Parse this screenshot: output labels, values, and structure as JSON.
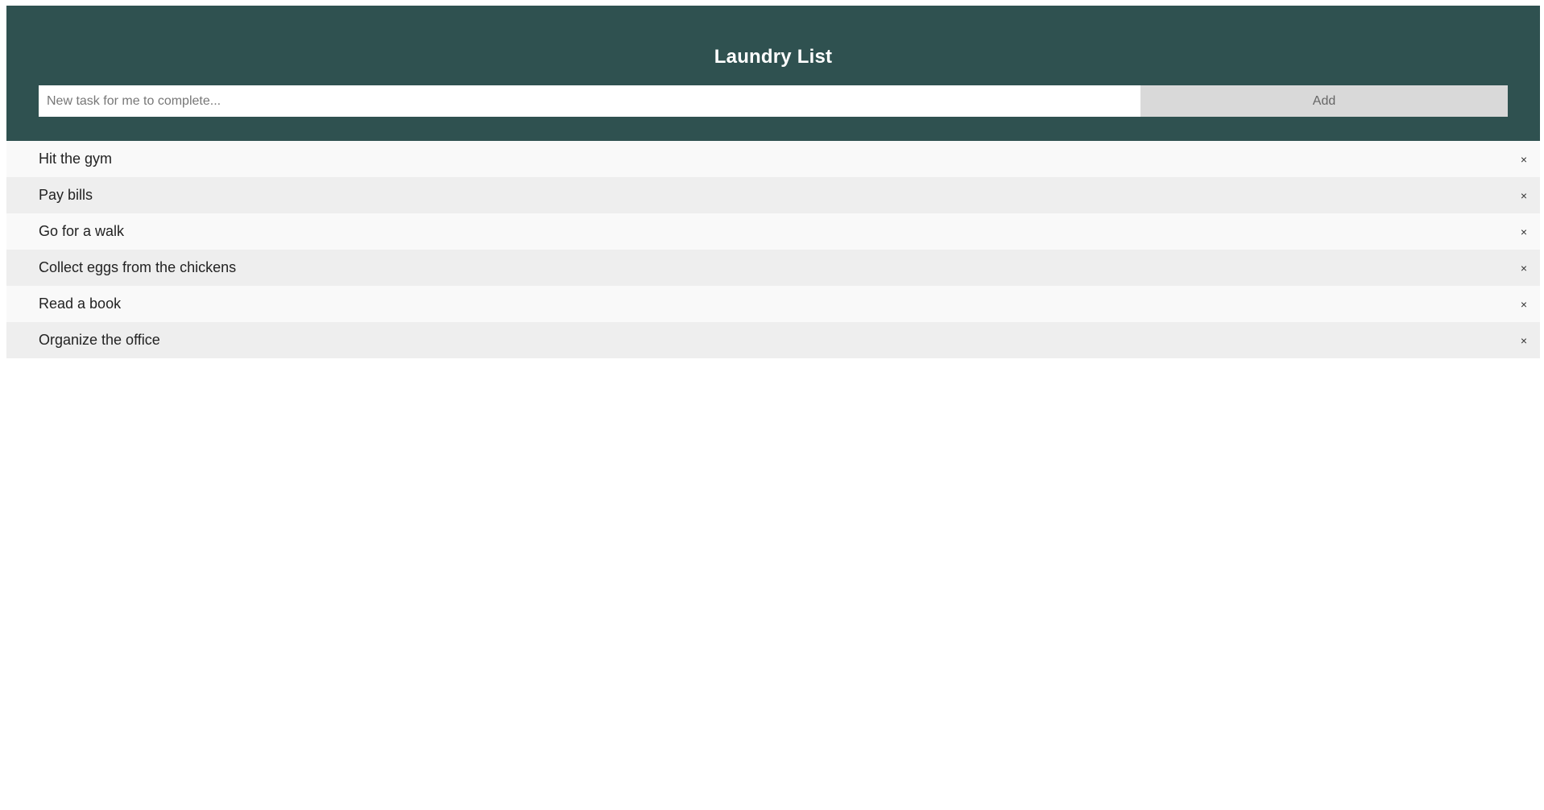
{
  "header": {
    "title": "Laundry List"
  },
  "add_form": {
    "input_placeholder": "New task for me to complete...",
    "input_value": "",
    "add_label": "Add"
  },
  "tasks": [
    {
      "label": "Hit the gym",
      "close": "×"
    },
    {
      "label": "Pay bills",
      "close": "×"
    },
    {
      "label": "Go for a walk",
      "close": "×"
    },
    {
      "label": "Collect eggs from the chickens",
      "close": "×"
    },
    {
      "label": "Read a book",
      "close": "×"
    },
    {
      "label": "Organize the office",
      "close": "×"
    }
  ],
  "colors": {
    "header_bg": "#2f5150",
    "row_light": "#f9f9f9",
    "row_dark": "#eeeeee",
    "add_button_bg": "#d9d9d9"
  },
  "icons": {
    "close": "close-icon"
  }
}
